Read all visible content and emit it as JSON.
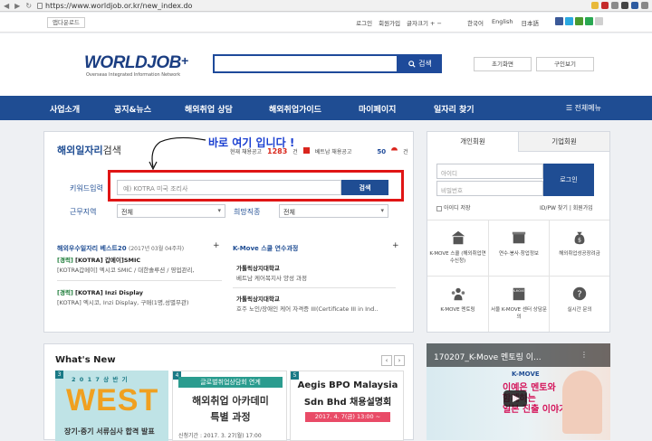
{
  "browser": {
    "url": "https://www.worldjob.or.kr/new_index.do"
  },
  "topbar": {
    "download": "앱다운로드",
    "util": [
      "로그인",
      "회원가입",
      "글자크기 + −"
    ],
    "languages": [
      "한국어",
      "English",
      "日本語"
    ]
  },
  "header": {
    "logo": "WORLDJOB",
    "logo_sub": "Overseas Integrated Information Network",
    "search_label": "검색",
    "home_btn": "초기화면",
    "guide_btn": "구인보기"
  },
  "nav": {
    "items": [
      "사업소개",
      "공지&뉴스",
      "해외취업 상담",
      "해외취업가이드",
      "마이페이지",
      "일자리 찾기"
    ],
    "menu": "전체메뉴"
  },
  "search_panel": {
    "title_a": "해외일자리",
    "title_b": "검색",
    "stat_label": "현재 채용공고",
    "stat_value": "1283",
    "stat_unit": "건",
    "vn_label": "베트남 채용공고",
    "vn_value": "50",
    "vn_unit": "건",
    "annotation": "바로 여기 입니다 !",
    "keyword_label": "키워드입력",
    "keyword_placeholder": "예) KOTRA 미국 조리사",
    "keyword_btn": "검색",
    "region_label": "근무지역",
    "region_value": "전체",
    "job_label": "희망직종",
    "job_value": "전체"
  },
  "best": {
    "title": "해외우수일자리 베스트20",
    "date": "(2017년 03월 04주차)",
    "items": [
      {
        "tag": "[경력]",
        "title": "[KOTRA] 갑메이]SMIC",
        "desc": "[KOTRA갑메이] 엑시코 SMIC / 대한솔루션 / 영업관리,"
      },
      {
        "tag": "[경력]",
        "title": "[KOTRA] Inzi Display",
        "desc": "[KOTRA] 엑시코, Inzi Display, 구매(1명,성별무관)"
      }
    ]
  },
  "kmove": {
    "title": "K-Move 스쿨 연수과정",
    "items": [
      {
        "title": "가톨릭상지대학교",
        "desc": "베트남 케어복지사 양성 과정"
      },
      {
        "title": "가톨릭상지대학교",
        "desc": "호주 노인/장애인 케어 자격증 III(Certificate III in Ind.."
      }
    ]
  },
  "login": {
    "tab_personal": "개인회원",
    "tab_company": "기업회원",
    "id_placeholder": "아이디",
    "pw_placeholder": "비밀번호",
    "login_btn": "로그인",
    "save_id": "아이디 저장",
    "find": "ID/PW 찾기 | 회원가입",
    "grid": [
      "K-MOVE 스쿨\n(해외취업연수신청)",
      "연수·봉사·창업정보",
      "해외취업성공장려금",
      "K-MOVE 멘토링",
      "서울 K-MOVE\n센터 상담문의",
      "실시간 문의"
    ]
  },
  "news": {
    "title": "What's New",
    "cards": [
      {
        "num": "3",
        "line1": "2 0 1 7 상 반 기",
        "line2": "WEST",
        "line3": "장기·중기 서류심사 합격 발표"
      },
      {
        "num": "4",
        "line1": "글로벌취업상담회 연계",
        "line2": "해외취업 아카데미",
        "line3": "특별 과정",
        "line4": "신청기간 : 2017. 3. 27(월) 17:00"
      },
      {
        "num": "5",
        "line1": "Aegis BPO Malaysia",
        "line2": "Sdn Bhd 채용설명회",
        "line3": "2017. 4. 7(금) 13:00 ~"
      }
    ]
  },
  "video": {
    "title": "170207_K-Move 멘토링 이...",
    "brand": "K-MOVE",
    "lines": [
      "이예은 멘토와",
      "함께하는",
      "일본 진출 이야기"
    ]
  }
}
